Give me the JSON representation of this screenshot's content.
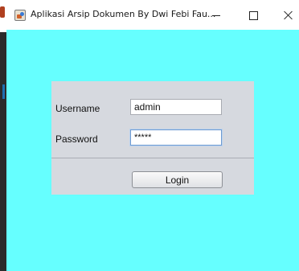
{
  "window": {
    "title": "Aplikasi Arsip Dokumen By Dwi Febi Fau...",
    "app_icon": "java-app-icon",
    "controls": {
      "minimize": "minimize-icon",
      "maximize": "maximize-icon",
      "close": "close-icon"
    }
  },
  "colors": {
    "content_background": "#66ffff",
    "panel_background": "#d6d9df"
  },
  "login_form": {
    "username_label": "Username",
    "username_value": "admin",
    "password_label": "Password",
    "password_value": "*****",
    "login_button": "Login"
  }
}
